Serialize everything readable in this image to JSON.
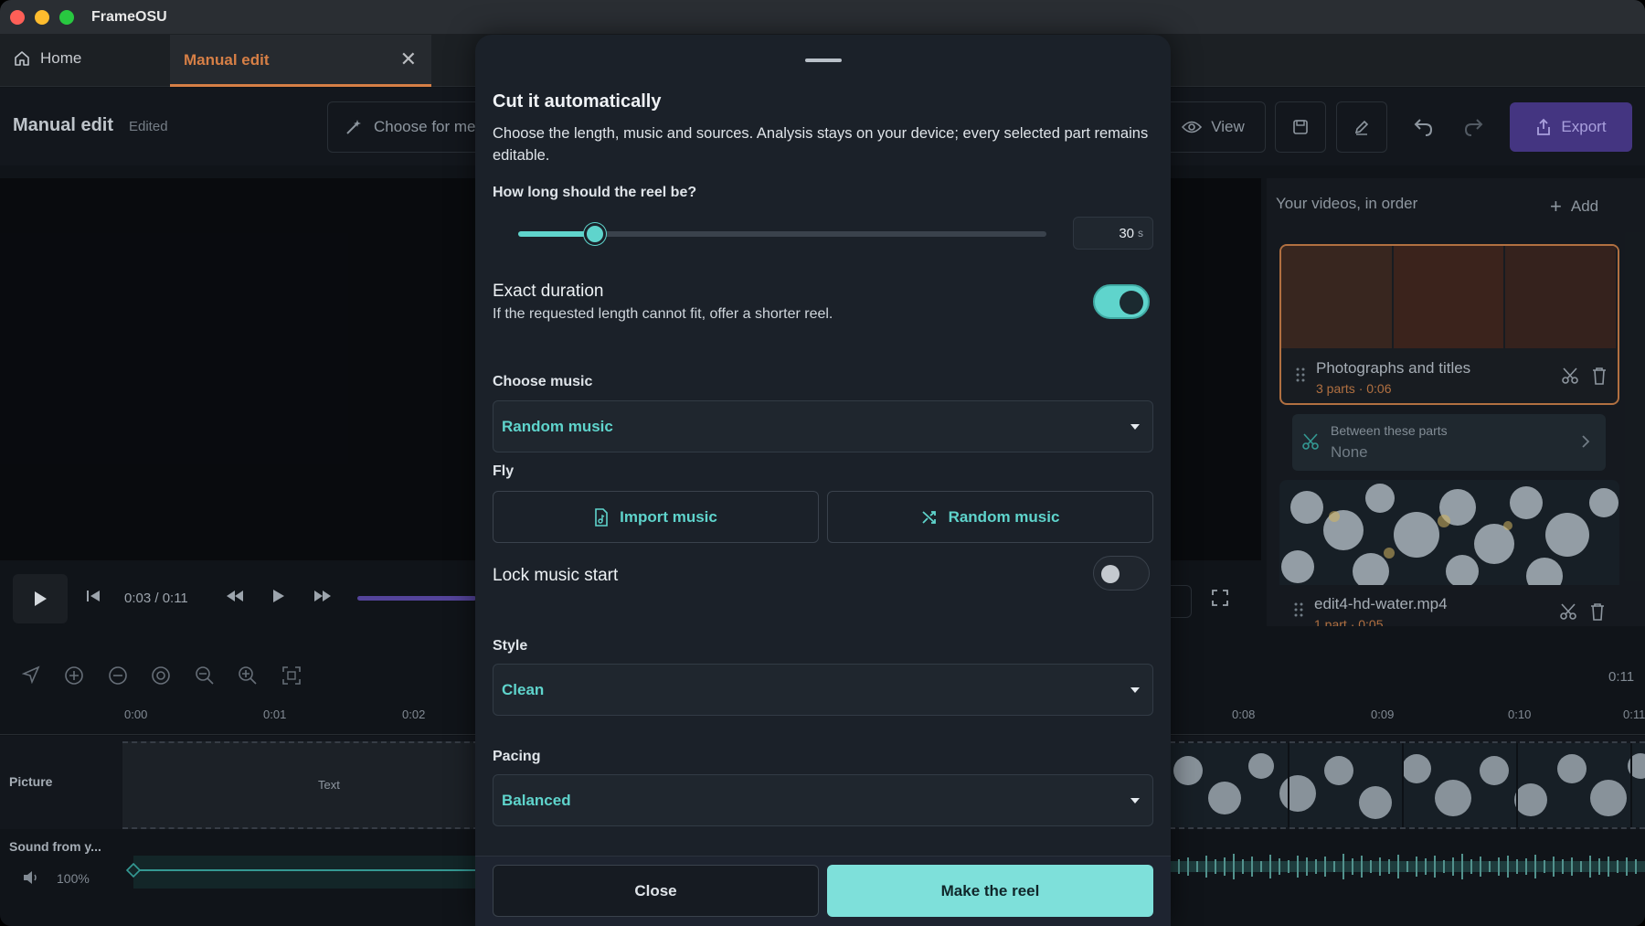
{
  "window": {
    "app_title": "FrameOSU"
  },
  "tabs": {
    "home_label": "Home",
    "manual_label": "Manual edit"
  },
  "toolbar": {
    "title": "Manual edit",
    "status": "Edited",
    "choose_label": "Choose for me",
    "view_label": "View",
    "export_label": "Export"
  },
  "player": {
    "time": "0:03 / 0:11",
    "progress_fraction": 0.27
  },
  "panel": {
    "title": "Your videos, in order",
    "add_label": "Add",
    "card1_title": "Photographs and titles",
    "card1_sub": "3 parts · 0:06",
    "between_label": "Between these parts",
    "between_value": "None",
    "card2_title": "edit4-hd-water.mp4",
    "card2_sub": "1 part · 0:05"
  },
  "timeline": {
    "end_time": "0:11",
    "ticks": [
      "0:00",
      "0:01",
      "0:02",
      "0:08",
      "0:09",
      "0:10",
      "0:11"
    ],
    "picture_label": "Picture",
    "picture_clip_text": "Text",
    "sound_label": "Sound from y...",
    "sound_volume": "100%"
  },
  "modal": {
    "title": "Cut it automatically",
    "description": "Choose the length, music and sources. Analysis stays on your device; every selected part remains editable.",
    "length_label": "How long should the reel be?",
    "length_value": "30",
    "length_unit": "s",
    "length_slider_fraction": 0.145,
    "exact_title": "Exact duration",
    "exact_sub": "If the requested length cannot fit, offer a shorter reel.",
    "exact_on": true,
    "music_label": "Choose music",
    "music_value": "Random music",
    "fly_label": "Fly",
    "import_music_label": "Import music",
    "random_music_label": "Random music",
    "lock_title": "Lock music start",
    "lock_on": false,
    "style_label": "Style",
    "style_value": "Clean",
    "pacing_label": "Pacing",
    "pacing_value": "Balanced",
    "close_label": "Close",
    "make_label": "Make the reel"
  },
  "colors": {
    "accent": "#5fd4cc",
    "tab_active": "#e98a4c",
    "export_bg": "#4a3a8c"
  }
}
